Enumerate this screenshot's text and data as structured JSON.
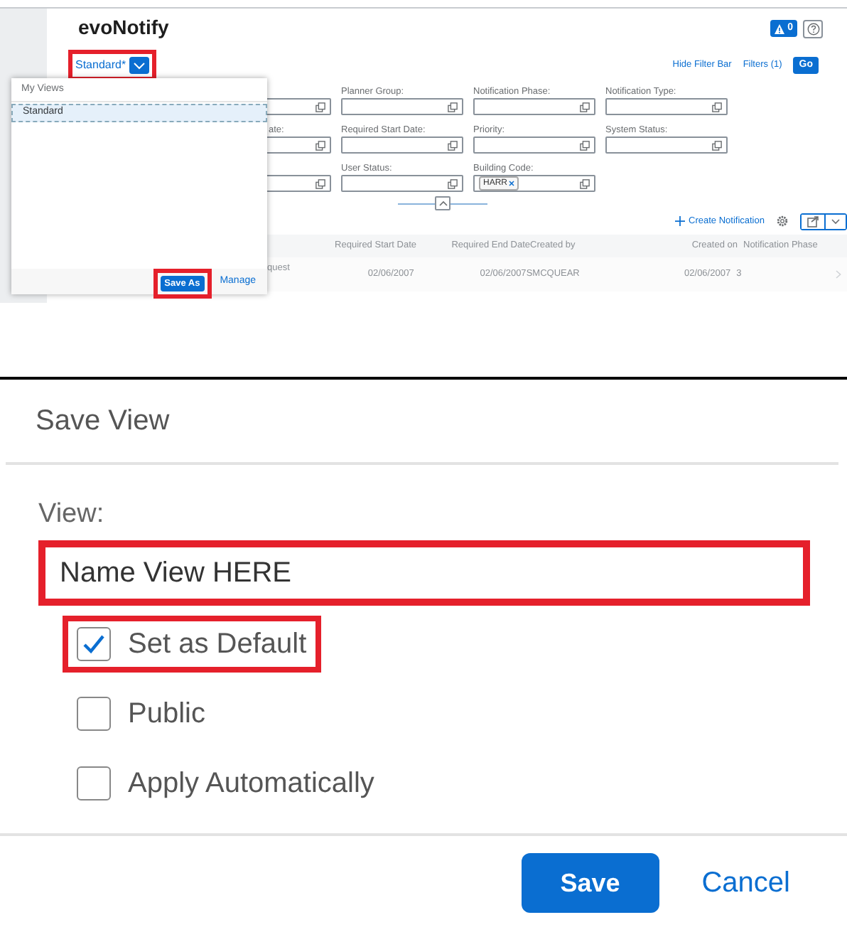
{
  "app": {
    "logo": "evoNotify",
    "alert_count": "0",
    "view_selector": {
      "label": "Standard*",
      "highlighted": true
    },
    "filter_links": [
      "Hide Filter Bar",
      "Filters (1)"
    ],
    "go_button": "Go",
    "filter_rows": [
      [
        {
          "kind": "field"
        },
        {
          "kind": "field",
          "label": "Planner Group:"
        },
        {
          "kind": "field",
          "label": "Notification Phase:"
        },
        {
          "kind": "field",
          "label": "Notification Type:"
        }
      ],
      [
        {
          "kind": "field",
          "label": "ate:"
        },
        {
          "kind": "field",
          "label": "Required Start Date:"
        },
        {
          "kind": "field",
          "label": "Priority:"
        },
        {
          "kind": "field",
          "label": "System Status:"
        }
      ],
      [
        {
          "kind": "field"
        },
        {
          "kind": "field",
          "label": "User Status:"
        },
        {
          "kind": "field",
          "label": "Building Code:",
          "tokens": [
            "HARR"
          ]
        },
        {
          "kind": "empty"
        }
      ]
    ],
    "create_button": "Create Notification",
    "table": {
      "columns": [
        "Required Start Date",
        "Required End Date",
        "Created by",
        "Created on",
        "Notification Phase"
      ],
      "rows": [
        {
          "first_cell": "quest",
          "cells": [
            "02/06/2007",
            "02/06/2007",
            "SMCQUEAR",
            "02/06/2007",
            "3"
          ]
        }
      ]
    },
    "views_popover": {
      "header": "My Views",
      "items": [
        {
          "label": "Standard",
          "selected": true
        }
      ],
      "save_as": {
        "label": "Save As",
        "highlighted": true
      },
      "manage": "Manage"
    }
  },
  "dialog": {
    "title": "Save View",
    "view_label": "View:",
    "name_field": {
      "value": "Name View HERE",
      "highlighted": true
    },
    "options": [
      {
        "label": "Set as Default",
        "checked": true,
        "highlighted": true
      },
      {
        "label": "Public",
        "checked": false,
        "highlighted": false
      },
      {
        "label": "Apply Automatically",
        "checked": false,
        "highlighted": false
      }
    ],
    "save_button": "Save",
    "cancel_button": "Cancel"
  }
}
